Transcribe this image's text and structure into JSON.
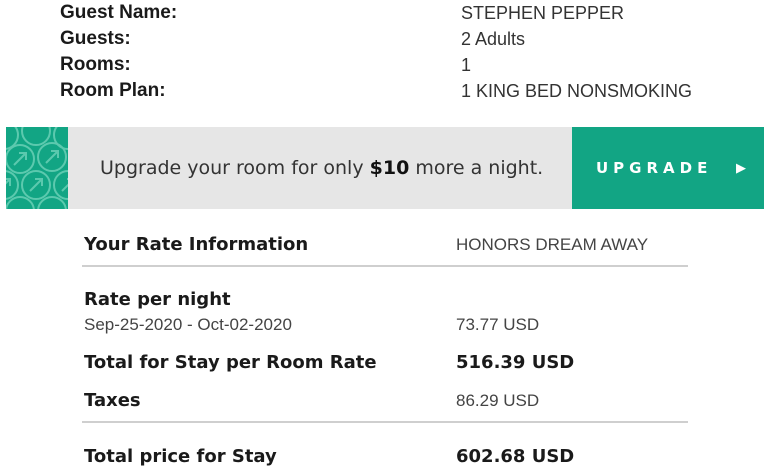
{
  "guest_info": {
    "guest_name_label": "Guest Name:",
    "guest_name_value": "STEPHEN PEPPER",
    "guests_label": "Guests:",
    "guests_value": "2 Adults",
    "rooms_label": "Rooms:",
    "rooms_value": "1",
    "room_plan_label": "Room Plan:",
    "room_plan_value": "1 KING BED NONSMOKING"
  },
  "upgrade_banner": {
    "text_prefix": "Upgrade your room for only ",
    "price": "$10",
    "text_suffix": " more a night.",
    "button_label": "UPGRADE",
    "arrow_icon": "play-arrow-icon",
    "accent_color": "#12a584",
    "background_color": "#e6e6e6"
  },
  "rate_info": {
    "heading": "Your Rate Information",
    "rate_name": "HONORS DREAM AWAY",
    "rate_per_night_label": "Rate per night",
    "date_range": "Sep-25-2020 - Oct-02-2020",
    "rate_per_night_value": "73.77 USD",
    "total_room_rate_label": "Total for Stay per Room Rate",
    "total_room_rate_value": "516.39 USD",
    "taxes_label": "Taxes",
    "taxes_value": "86.29 USD",
    "total_price_label": "Total price for Stay",
    "total_price_value": "602.68 USD"
  }
}
